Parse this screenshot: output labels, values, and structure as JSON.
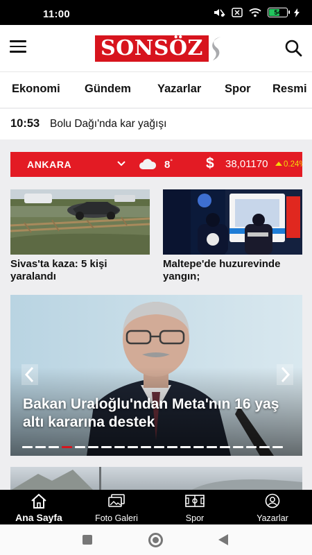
{
  "status_bar": {
    "time": "11:00",
    "battery_level": "54",
    "icons": [
      "mute-icon",
      "close-box-icon",
      "wifi-icon",
      "battery-icon",
      "charging-icon"
    ]
  },
  "header": {
    "logo_text": "SONSÖZ",
    "icons": [
      "hamburger-menu-icon",
      "search-icon"
    ]
  },
  "categories": [
    "Ekonomi",
    "Gündem",
    "Yazarlar",
    "Spor",
    "Resmi"
  ],
  "breaking_news": {
    "time": "10:53",
    "text": "Bolu Dağı'nda kar yağışı"
  },
  "weather_bar": {
    "city": "ANKARA",
    "weather_icon": "cloud-icon",
    "temperature": "8",
    "degree_symbol": "°",
    "currency_symbol": "$",
    "rate": "38,01170",
    "change": "0.24%",
    "colors": {
      "background": "#e31b24",
      "change": "#f5d90a"
    }
  },
  "news_cards": [
    {
      "title": "Sivas'ta kaza: 5 kişi yaralandı"
    },
    {
      "title": "Maltepe'de huzurevinde yangın;"
    }
  ],
  "slider": {
    "caption": "Bakan Uraloğlu'ndan Meta'nın 16 yaş altı kararına destek",
    "slide_count": 20,
    "active_index": 3
  },
  "bottom_nav": [
    {
      "label": "Ana Sayfa",
      "icon": "home-icon",
      "active": true
    },
    {
      "label": "Foto Galeri",
      "icon": "photo-gallery-icon",
      "active": false
    },
    {
      "label": "Spor",
      "icon": "sports-field-icon",
      "active": false
    },
    {
      "label": "Yazarlar",
      "icon": "user-icon",
      "active": false
    }
  ],
  "colors": {
    "brand": "#d7141d",
    "nav_background": "#000000"
  }
}
